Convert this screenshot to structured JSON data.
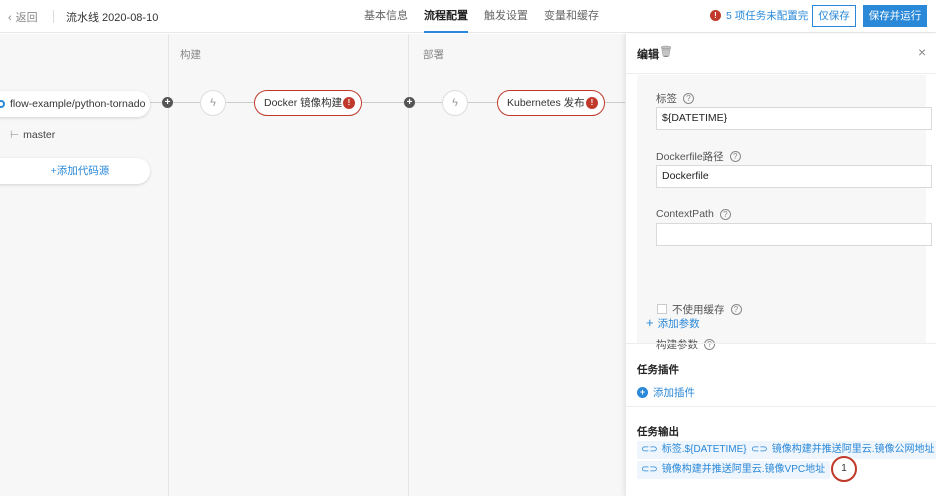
{
  "topbar": {
    "back_label": "返回",
    "title": "流水线 2020-08-10",
    "tabs": [
      {
        "label": "基本信息"
      },
      {
        "label": "流程配置"
      },
      {
        "label": "触发设置"
      },
      {
        "label": "变量和缓存"
      }
    ],
    "warning_text": "5 项任务未配置完",
    "save_only_label": "仅保存",
    "save_run_label": "保存并运行"
  },
  "canvas": {
    "stages": [
      {
        "label": "构建"
      },
      {
        "label": "部署"
      }
    ],
    "source": {
      "repo": "flow-example/python-tornado",
      "branch": "master",
      "add_source_label": "+添加代码源"
    },
    "tasks": [
      {
        "label": "Docker 镜像构建"
      },
      {
        "label": "Kubernetes 发布"
      }
    ]
  },
  "panel": {
    "title": "编辑",
    "fields": {
      "tag_label": "标签",
      "tag_value": "${DATETIME}",
      "dockerfile_label": "Dockerfile路径",
      "dockerfile_value": "Dockerfile",
      "context_label": "ContextPath",
      "context_value": "",
      "nocache_label": "不使用缓存",
      "params_label": "构建参数",
      "add_param_label": "添加参数"
    },
    "plugins": {
      "title": "任务插件",
      "add_label": "添加插件"
    },
    "outputs": {
      "title": "任务输出",
      "tags": [
        "标签.${DATETIME}",
        "镜像构建并推送阿里云.镜像公网地址",
        "镜像构建并推送阿里云.镜像VPC地址"
      ],
      "count": "1"
    }
  },
  "colors": {
    "accent": "#2a88d8",
    "error": "#c0392b"
  }
}
